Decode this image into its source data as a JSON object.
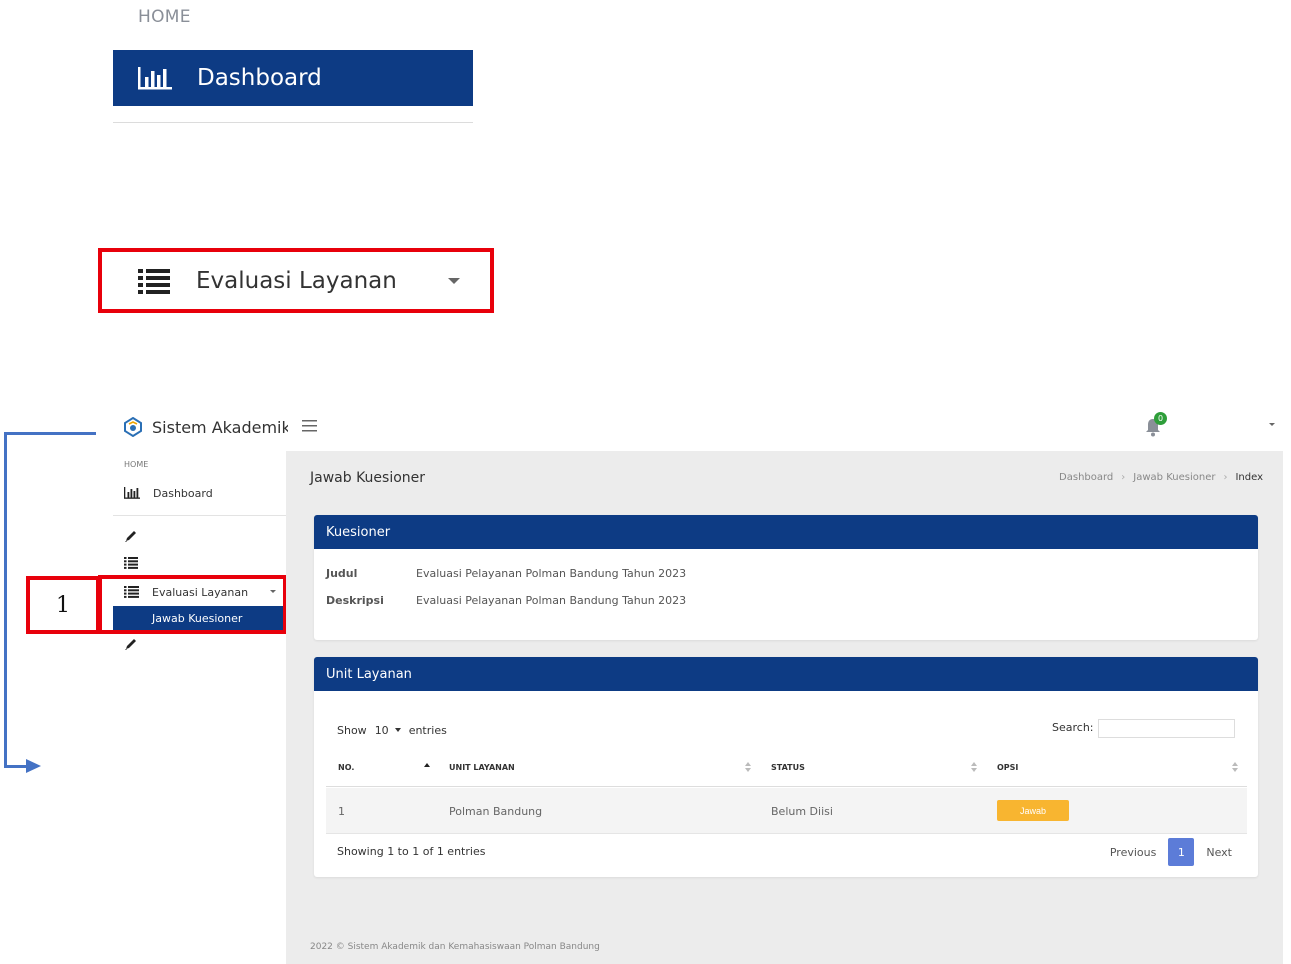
{
  "zoom": {
    "home_label": "HOME",
    "dashboard_label": "Dashboard",
    "evaluasi_label": "Evaluasi Layanan"
  },
  "annotation": {
    "number": "1",
    "highlight_color": "#e8000b",
    "arrow_color": "#4472c4"
  },
  "topbar": {
    "brand": "Sistem Akademik",
    "notification_count": "0"
  },
  "sidebar": {
    "home_label": "HOME",
    "dashboard_label": "Dashboard",
    "evaluasi_label": "Evaluasi Layanan",
    "submenu_label": "Jawab Kuesioner",
    "accent": "#0d3b84"
  },
  "page": {
    "title": "Jawab Kuesioner",
    "breadcrumb": [
      "Dashboard",
      "Jawab Kuesioner",
      "Index"
    ]
  },
  "kuesioner": {
    "header": "Kuesioner",
    "judul_label": "Judul",
    "judul_value": "Evaluasi Pelayanan Polman Bandung Tahun 2023",
    "deskripsi_label": "Deskripsi",
    "deskripsi_value": "Evaluasi Pelayanan Polman Bandung Tahun 2023"
  },
  "unit": {
    "header": "Unit Layanan",
    "show_label": "Show",
    "entries_value": "10",
    "entries_label": "entries",
    "search_label": "Search:",
    "search_value": "",
    "columns": [
      "NO.",
      "UNIT LAYANAN",
      "STATUS",
      "OPSI"
    ],
    "rows": [
      {
        "no": "1",
        "unit": "Polman Bandung",
        "status": "Belum Diisi",
        "action": "Jawab"
      }
    ],
    "info": "Showing 1 to 1 of 1 entries",
    "pager": {
      "prev": "Previous",
      "page": "1",
      "next": "Next"
    }
  },
  "footer": {
    "text": "2022 © Sistem Akademik dan Kemahasiswaan Polman Bandung"
  }
}
